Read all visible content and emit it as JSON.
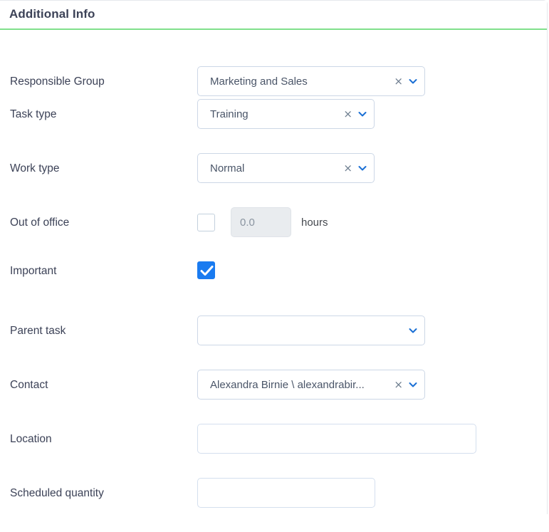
{
  "panel": {
    "title": "Additional Info",
    "accent_color": "#80e08b",
    "checkbox_color": "#1a7bf0",
    "chevron_color": "#1a6fd4",
    "clear_icon_color": "#6b7b8d"
  },
  "fields": {
    "responsible_group": {
      "label": "Responsible Group",
      "value": "Marketing and Sales",
      "clear_label": "×"
    },
    "task_type": {
      "label": "Task type",
      "value": "Training",
      "clear_label": "×"
    },
    "work_type": {
      "label": "Work type",
      "value": "Normal",
      "clear_label": "×"
    },
    "out_of_office": {
      "label": "Out of office",
      "checked": false,
      "hours_value": "0.0",
      "hours_placeholder": "0.0",
      "hours_unit": "hours"
    },
    "important": {
      "label": "Important",
      "checked": true
    },
    "parent_task": {
      "label": "Parent task",
      "value": ""
    },
    "contact": {
      "label": "Contact",
      "value": "Alexandra Birnie \\ alexandrabir...",
      "clear_label": "×"
    },
    "location": {
      "label": "Location",
      "value": "",
      "placeholder": ""
    },
    "scheduled_quantity": {
      "label": "Scheduled quantity",
      "value": "",
      "placeholder": ""
    }
  }
}
